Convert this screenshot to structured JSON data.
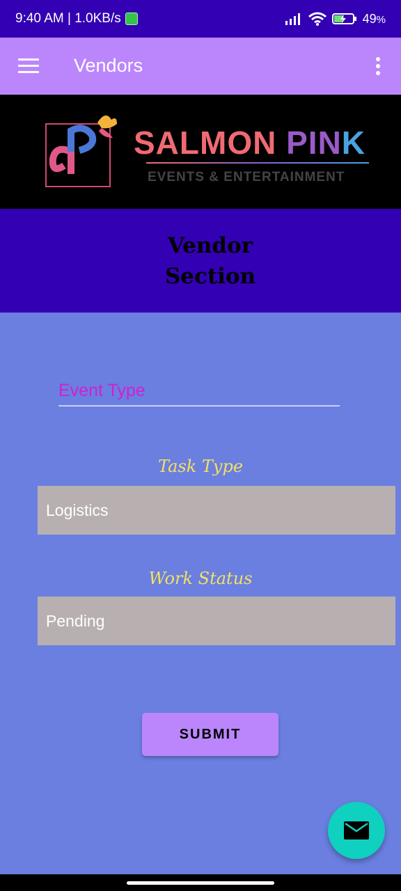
{
  "status_bar": {
    "time_speed": "9:40 AM | 1.0KB/s",
    "battery": "49"
  },
  "toolbar": {
    "title": "Vendors",
    "menu_icon": "hamburger-menu-icon",
    "more_icon": "more-vert-icon"
  },
  "banner": {
    "brand_part1": "SALMON ",
    "brand_part2": "PIN",
    "brand_part3": "K",
    "tagline": "EVENTS & ENTERTAINMENT"
  },
  "section": {
    "title": "Vendor Section"
  },
  "form": {
    "event_type_placeholder": "Event Type",
    "task_type_label": "Task Type",
    "task_type_value": "Logistics",
    "work_status_label": "Work Status",
    "work_status_value": "Pending",
    "submit_label": "SUBMIT"
  },
  "fab": {
    "icon": "mail-icon"
  },
  "colors": {
    "status_bar": "#3300b3",
    "toolbar": "#bb86fc",
    "background": "#6a7fe0",
    "label": "#f4e060",
    "fab": "#10d0c0",
    "input_text": "#d020d0"
  }
}
